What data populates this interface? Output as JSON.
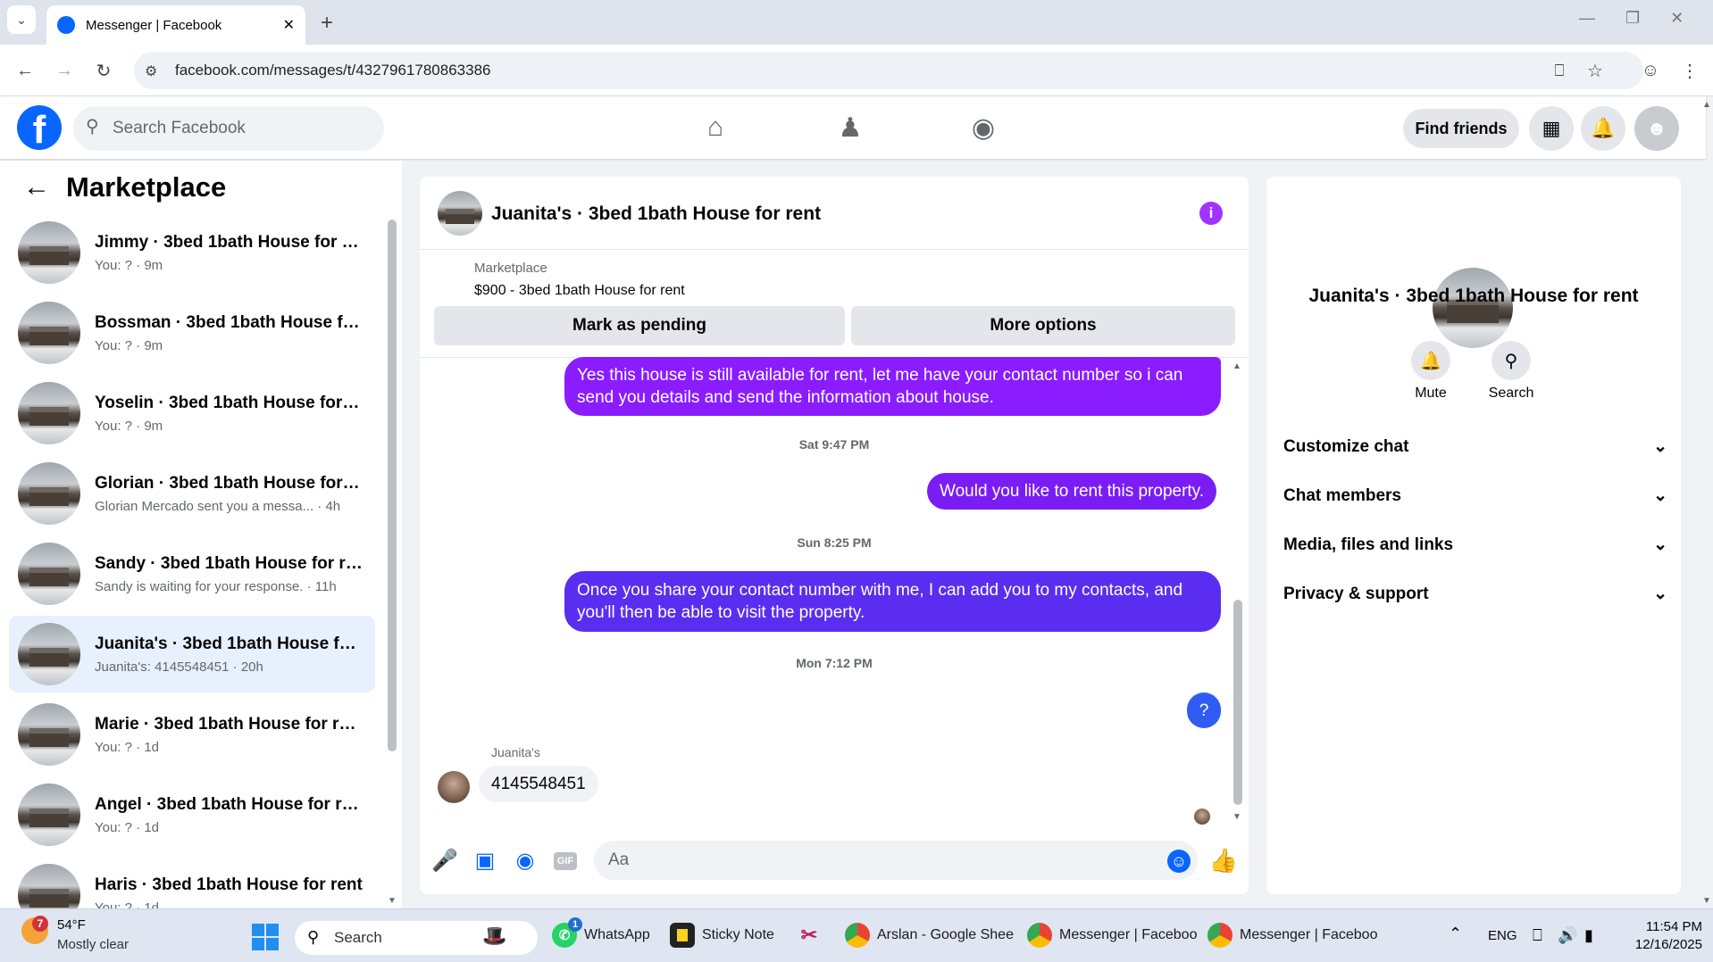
{
  "browser": {
    "tab_title": "Messenger | Facebook",
    "new_tab": "+",
    "url": "facebook.com/messages/t/4327961780863386",
    "window_controls": [
      "—",
      "❐",
      "✕"
    ]
  },
  "header": {
    "logo": "f",
    "search_placeholder": "Search Facebook",
    "find_friends": "Find friends"
  },
  "sidebar": {
    "title": "Marketplace",
    "conversations": [
      {
        "title": "Jimmy · 3bed 1bath House for re...",
        "subtitle": "You: ? · 9m"
      },
      {
        "title": "Bossman · 3bed 1bath House for...",
        "subtitle": "You: ? · 9m"
      },
      {
        "title": "Yoselin · 3bed 1bath House for r...",
        "subtitle": "You: ? · 9m"
      },
      {
        "title": "Glorian · 3bed 1bath House for r...",
        "subtitle": "Glorian Mercado sent you a messa...  · 4h"
      },
      {
        "title": "Sandy · 3bed 1bath House for rent",
        "subtitle": "Sandy is waiting for your response. · 11h"
      },
      {
        "title": "Juanita's · 3bed 1bath House for...",
        "subtitle": "Juanita's: 4145548451 · 20h"
      },
      {
        "title": "Marie · 3bed 1bath House for rent",
        "subtitle": "You: ? · 1d"
      },
      {
        "title": "Angel · 3bed 1bath House for rent",
        "subtitle": "You: ? · 1d"
      },
      {
        "title": "Haris · 3bed 1bath House for rent",
        "subtitle": "You: ? · 1d"
      }
    ]
  },
  "chat": {
    "title": "Juanita's · 3bed 1bath House for rent",
    "listing_label": "Marketplace",
    "listing_price": "$900 - 3bed 1bath House for rent",
    "mark_pending": "Mark as pending",
    "more_options": "More options",
    "messages": [
      {
        "text": "Yes this house is still available for rent, let me have your contact number so i can send you details and send the information about house.",
        "color": "#8a1cff"
      },
      {
        "timestamp": "Sat 9:47 PM"
      },
      {
        "text": "Would you like to rent this property.",
        "color": "#7a1df5"
      },
      {
        "timestamp": "Sun 8:25 PM"
      },
      {
        "text": "Once you share your contact number with me, I can add you to my contacts, and you'll then be able to visit the property.",
        "color": "#5b2df0"
      },
      {
        "timestamp": "Mon 7:12 PM"
      },
      {
        "text": "?",
        "color": "#2f5cf2"
      },
      {
        "sender": "Juanita's",
        "text": "4145548451"
      }
    ],
    "composer_placeholder": "Aa",
    "gif_label": "GIF"
  },
  "details": {
    "title": "Juanita's · 3bed 1bath House for rent",
    "mute": "Mute",
    "search": "Search",
    "sections": [
      "Customize chat",
      "Chat members",
      "Media, files and links",
      "Privacy & support"
    ]
  },
  "taskbar": {
    "weather_temp": "54°F",
    "weather_desc": "Mostly clear",
    "weather_badge": "7",
    "search": "Search",
    "apps": [
      {
        "label": "WhatsApp",
        "badge": "1"
      },
      {
        "label": "Sticky Note"
      },
      {
        "label": "Arslan - Google Shee"
      },
      {
        "label": "Messenger | Faceboo"
      },
      {
        "label": "Messenger | Faceboo"
      }
    ],
    "lang": "ENG",
    "time": "11:54 PM",
    "date": "12/16/2025"
  },
  "colors": {
    "fb_blue": "#0866ff",
    "accent_purple": "#a033ff",
    "selected_row": "#e7f0fd"
  }
}
